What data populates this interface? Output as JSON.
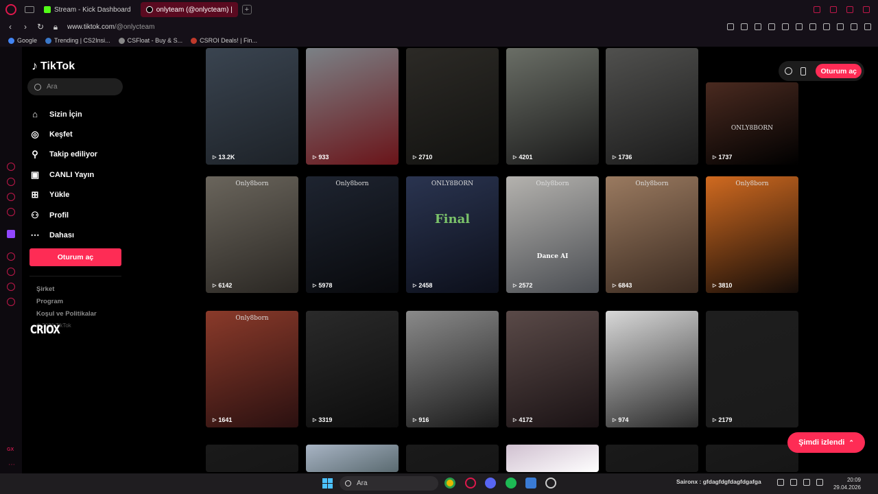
{
  "browser": {
    "tabs": [
      {
        "label": "Stream - Kick Dashboard",
        "active": false
      },
      {
        "label": "onlyteam (@onlycteam) |",
        "active": true
      }
    ],
    "url_host": "www.tiktok.com",
    "url_path": "/@onlycteam",
    "bookmarks": [
      {
        "label": "Google",
        "color": "#4285f4"
      },
      {
        "label": "Trending | CS2Insi...",
        "color": "#3a78c9"
      },
      {
        "label": "CSFloat - Buy & S...",
        "color": "#888888"
      },
      {
        "label": "CSROI Deals! | Fin...",
        "color": "#c0392b"
      }
    ]
  },
  "tiktok": {
    "logo": "TikTok",
    "search_placeholder": "Ara",
    "nav": [
      {
        "label": "Sizin İçin",
        "icon": "home-icon"
      },
      {
        "label": "Keşfet",
        "icon": "compass-icon"
      },
      {
        "label": "Takip ediliyor",
        "icon": "user-plus-icon"
      },
      {
        "label": "CANLI Yayın",
        "icon": "live-icon"
      },
      {
        "label": "Yükle",
        "icon": "upload-icon"
      },
      {
        "label": "Profil",
        "icon": "profile-icon"
      },
      {
        "label": "Dahası",
        "icon": "more-icon"
      }
    ],
    "login_label": "Oturum aç",
    "footer": [
      "Şirket",
      "Program",
      "Koşul ve Politikalar"
    ],
    "copyright": "© 2026 TikTok",
    "overlay_text": "CRIOX"
  },
  "videos": [
    {
      "views": "13.2K",
      "colors": [
        "#3a4450",
        "#1d2228"
      ]
    },
    {
      "views": "933",
      "colors": [
        "#7b8186",
        "#6a1419"
      ]
    },
    {
      "views": "2710",
      "colors": [
        "#2c2a26",
        "#121210"
      ]
    },
    {
      "views": "4201",
      "colors": [
        "#6a6e66",
        "#1a1a1a"
      ]
    },
    {
      "views": "1736",
      "colors": [
        "#50504e",
        "#1b1b1b"
      ]
    },
    {
      "views": "1737",
      "colors": [
        "#4a2a20",
        "#000000"
      ],
      "watermark": "ONLY8BORN"
    },
    {
      "views": "6142",
      "colors": [
        "#6a655c",
        "#2a2723"
      ],
      "watermark": "Only8born"
    },
    {
      "views": "5978",
      "colors": [
        "#1e2430",
        "#08090c"
      ],
      "watermark": "Only8born"
    },
    {
      "views": "2458",
      "colors": [
        "#2a3450",
        "#0c0f1a"
      ],
      "watermark": "ONLY8BORN",
      "caption": "Final"
    },
    {
      "views": "2572",
      "colors": [
        "#b4b2ae",
        "#4a4d52"
      ],
      "watermark": "Only8born",
      "caption": "Dance AI"
    },
    {
      "views": "6843",
      "colors": [
        "#9a7a60",
        "#3a2a20"
      ],
      "watermark": "Only8born"
    },
    {
      "views": "3810",
      "colors": [
        "#d06a20",
        "#140c08"
      ],
      "watermark": "Only8born"
    },
    {
      "views": "1641",
      "colors": [
        "#8a3a2a",
        "#2a1010"
      ],
      "watermark": "Only8born"
    },
    {
      "views": "3319",
      "colors": [
        "#2a2a2a",
        "#0c0c0c"
      ]
    },
    {
      "views": "916",
      "colors": [
        "#8a8a8a",
        "#1a1a1a"
      ]
    },
    {
      "views": "4172",
      "colors": [
        "#5a4a48",
        "#1a1214"
      ]
    },
    {
      "views": "974",
      "colors": [
        "#d8d8d8",
        "#2a2a2a"
      ]
    },
    {
      "views": "2179",
      "colors": [
        "#1e1e1e",
        "#1a1a1a"
      ]
    },
    {
      "views": "",
      "colors": [
        "#1a1a1a",
        "#161616"
      ]
    },
    {
      "views": "",
      "colors": [
        "#a8b4c4",
        "#5a6a70"
      ]
    },
    {
      "views": "",
      "colors": [
        "#1a1a1a",
        "#161616"
      ]
    },
    {
      "views": "",
      "colors": [
        "#d0c0d0",
        "#ffffff"
      ]
    },
    {
      "views": "",
      "colors": [
        "#1a1a1a",
        "#161616"
      ]
    },
    {
      "views": "",
      "colors": [
        "#1a1a1a",
        "#161616"
      ]
    }
  ],
  "top_right": {
    "login_label": "Oturum aç"
  },
  "watched_button": "Şimdi izlendi",
  "taskbar": {
    "search_placeholder": "Ara",
    "tray_text": "Saironx : gfdagfdgfdagfdgafga",
    "time": "20:09",
    "date": "29.04.2026"
  }
}
